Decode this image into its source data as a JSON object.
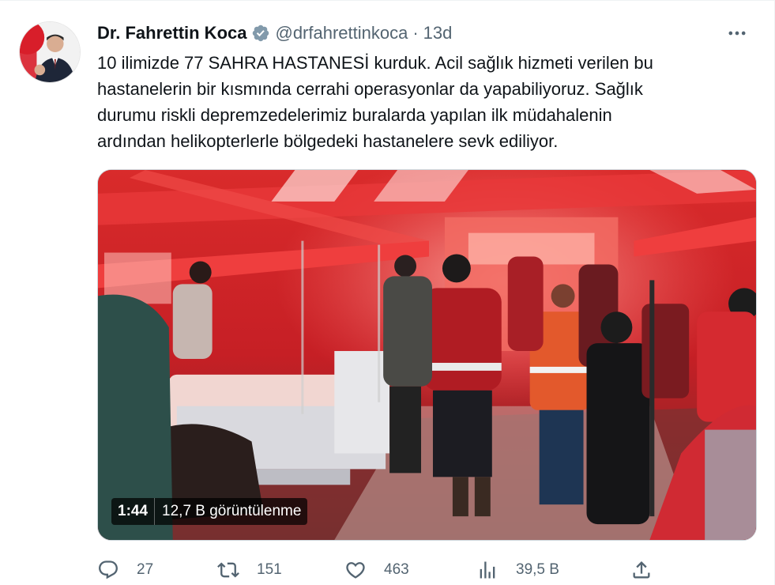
{
  "tweet": {
    "author_name": "Dr. Fahrettin Koca",
    "handle": "@drfahrettinkoca",
    "separator": "·",
    "time": "13d",
    "text": "10 ilimizde 77 SAHRA HASTANESİ kurduk. Acil sağlık hizmeti verilen bu\nhastanelerin bir kısmında cerrahi operasyonlar da yapabiliyoruz. Sağlık\ndurumu riskli depremzedelerimiz buralarda yapılan ilk müdahalenin\nardından helikopterlerle bölgedeki hastanelere sevk ediliyor."
  },
  "media": {
    "duration": "1:44",
    "views": "12,7 B görüntülenme"
  },
  "actions": {
    "replies": "27",
    "retweets": "151",
    "likes": "463",
    "views": "39,5 B"
  },
  "icons": {
    "verified": "verified-badge-icon",
    "more": "more-icon",
    "reply": "reply-icon",
    "retweet": "retweet-icon",
    "like": "heart-icon",
    "analytics": "analytics-icon",
    "share": "share-icon"
  },
  "colors": {
    "text_primary": "#0f1419",
    "text_secondary": "#536471",
    "verified": "#829aab",
    "border": "#cfd9de"
  }
}
